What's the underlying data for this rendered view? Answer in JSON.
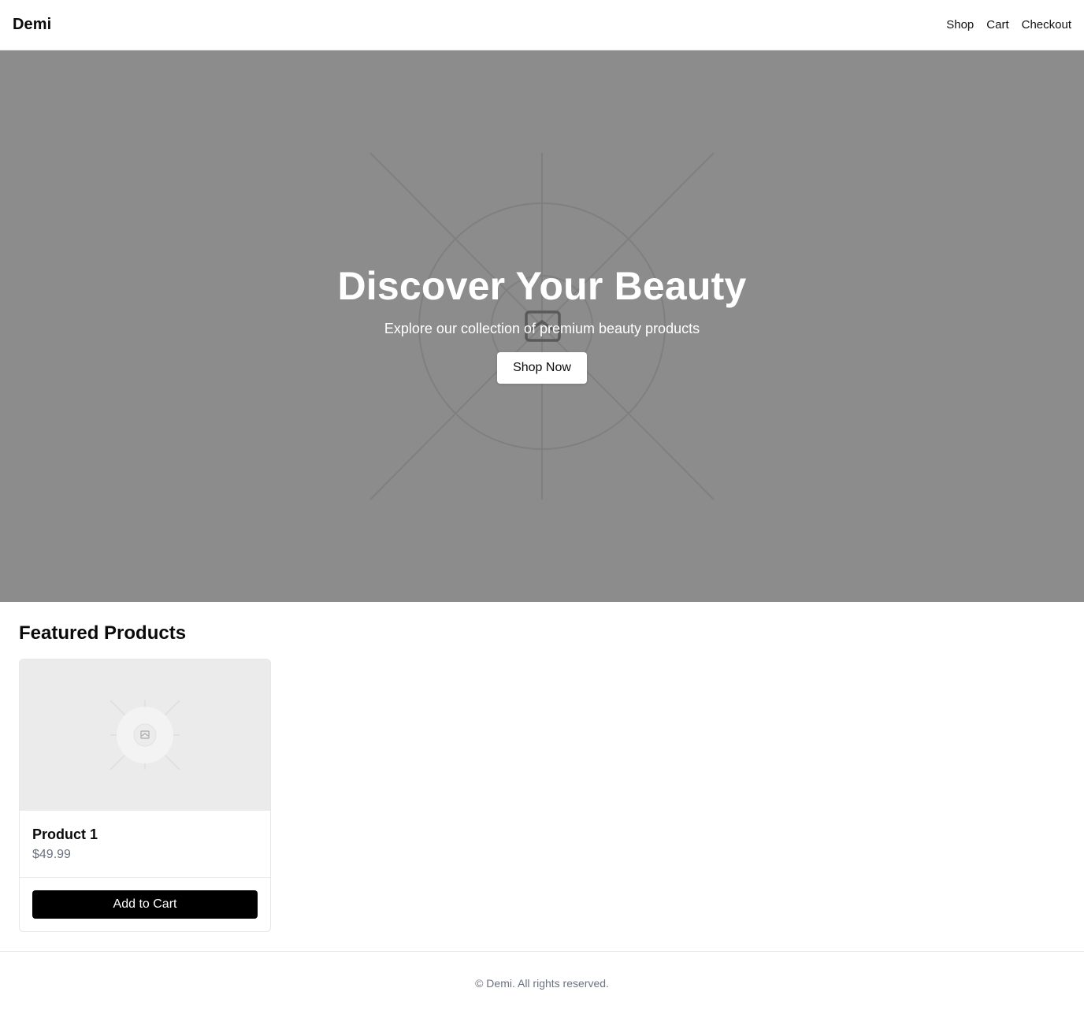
{
  "header": {
    "brand": "Demi",
    "nav": [
      {
        "label": "Shop"
      },
      {
        "label": "Cart"
      },
      {
        "label": "Checkout"
      }
    ]
  },
  "hero": {
    "title": "Discover Your Beauty",
    "subtitle": "Explore our collection of premium beauty products",
    "cta_label": "Shop Now",
    "background_color": "#8c8c8c",
    "image_icon": "image-placeholder-icon"
  },
  "featured": {
    "title": "Featured Products",
    "products": [
      {
        "name": "Product 1",
        "price": "$49.99",
        "button_label": "Add to Cart",
        "image_icon": "image-placeholder-icon"
      }
    ]
  },
  "footer": {
    "text": "© Demi. All rights reserved."
  },
  "colors": {
    "accent_button": "#000000",
    "price_text": "#6b7280",
    "image_placeholder_bg": "#ebebeb"
  }
}
